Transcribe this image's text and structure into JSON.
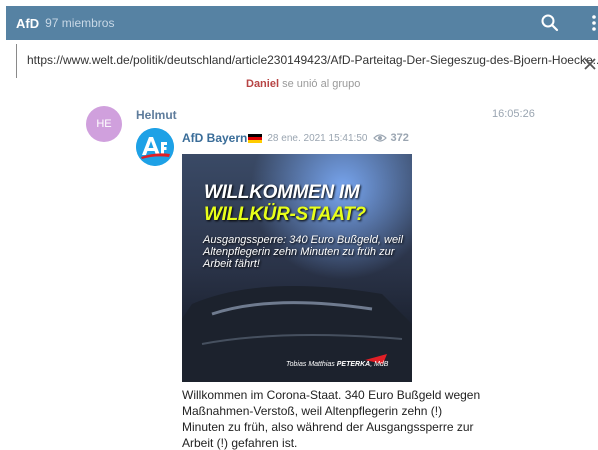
{
  "header": {
    "title": "AfD",
    "members": "97 miembros",
    "icons": [
      "search-icon",
      "more-vertical-icon"
    ],
    "background": "#5682a3"
  },
  "link_preview": {
    "url": "https://www.welt.de/politik/deutschland/article230149423/AfD-Parteitag-Der-Siegeszug-des-Bjoern-Hoecke...",
    "icons": [
      "close-icon"
    ]
  },
  "service_message": {
    "name": "Daniel",
    "text": "se unió al grupo"
  },
  "message": {
    "avatar_initials": "HE",
    "avatar_color": "#d0a0dd",
    "sender": "Helmut",
    "time": "16:05:26",
    "forward": {
      "channel": "AfD Bayern",
      "flag_icon": "german-flag-icon",
      "date": "28 ene. 2021 15:41:50",
      "views": "372",
      "avatar_icon": "afd-logo-icon"
    },
    "image": {
      "headline_1": "WILLKOMMEN IM",
      "headline_2": "WILLKÜR-STAAT?",
      "subtitle": "Ausgangssperre: 340 Euro Bußgeld, weil Altenpflegerin zehn Minuten zu früh zur Arbeit fährt!",
      "credit_name": "Tobias Matthias",
      "credit_strong": "PETERKA",
      "credit_suffix": "MdB"
    },
    "text": "Willkommen im Corona-Staat. 340 Euro Bußgeld wegen Maßnahmen-Verstoß, weil Altenpflegerin zehn (!) Minuten zu früh, also während der Ausgangssperre zur Arbeit (!) gefahren ist."
  }
}
